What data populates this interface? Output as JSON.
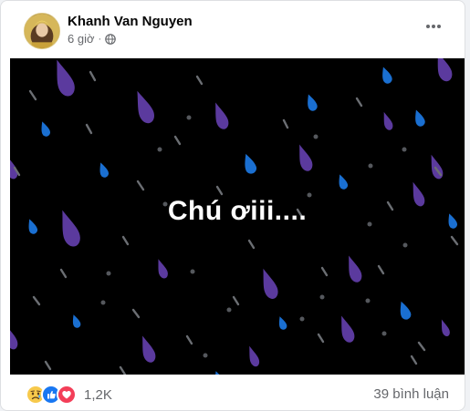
{
  "post": {
    "author": "Khanh Van Nguyen",
    "time": "6 giờ",
    "separator": "·",
    "privacy_icon": "globe-icon",
    "more_icon": "more-horizontal-icon",
    "text": "Chú ơiii....",
    "background": "rain-drops-dark",
    "colors": {
      "background": "#000000",
      "drop_purple": "#5b3a9e",
      "drop_blue": "#1a6fd1",
      "streak_gray": "#6b6e73",
      "text": "#ffffff"
    }
  },
  "footer": {
    "reactions": [
      "sad",
      "like",
      "love"
    ],
    "reaction_count": "1,2K",
    "comments": "39 bình luận"
  }
}
